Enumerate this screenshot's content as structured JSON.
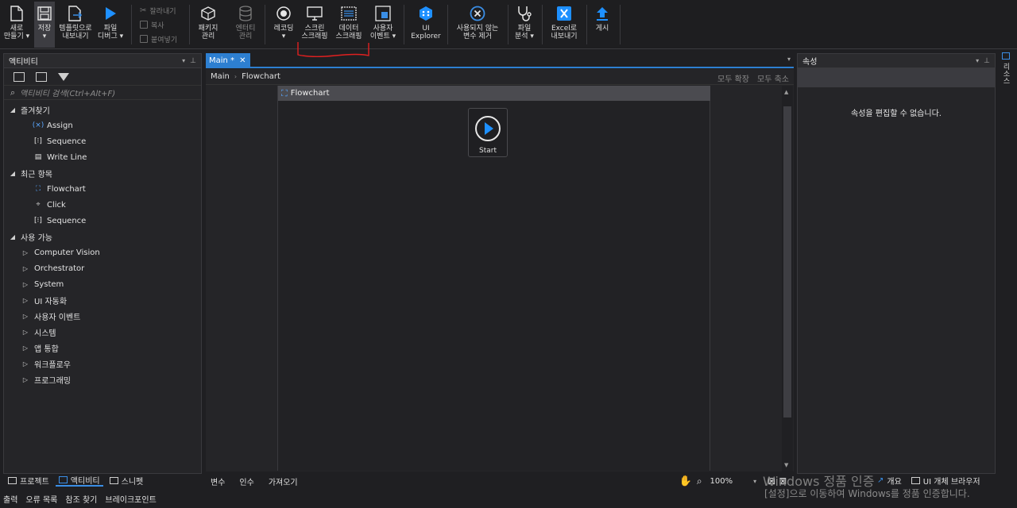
{
  "ribbon": {
    "new": "새로\n만들기 ▾",
    "save": "저장\n▾",
    "export_template": "템플릿으로\n내보내기",
    "debug_file": "파일\n디버그 ▾",
    "cut": "잘라내기",
    "copy": "복사",
    "paste": "붙여넣기",
    "manage_packages": "패키지\n관리",
    "manage_entities": "엔터티\n관리",
    "recording": "레코딩\n▾",
    "screen_scraping": "스크린\n스크래핑",
    "data_scraping": "데이터\n스크래핑",
    "user_events": "사용자\n이벤트 ▾",
    "ui_explorer": "UI\nExplorer",
    "remove_unused": "사용되지 않는\n변수 제거",
    "analyze_file": "파일\n분석 ▾",
    "export_excel": "Excel로\n내보내기",
    "publish": "게시"
  },
  "activities_panel": {
    "title": "액티비티",
    "search_placeholder": "액티비티 검색(Ctrl+Alt+F)",
    "sections": [
      {
        "label": "즐겨찾기",
        "items": [
          "Assign",
          "Sequence",
          "Write Line"
        ]
      },
      {
        "label": "최근 항목",
        "items": [
          "Flowchart",
          "Click",
          "Sequence"
        ]
      },
      {
        "label": "사용 가능",
        "items": [
          "Computer Vision",
          "Orchestrator",
          "System",
          "UI 자동화",
          "사용자 이벤트",
          "시스템",
          "앱 통합",
          "워크플로우",
          "프로그래밍"
        ]
      }
    ],
    "bottom_tabs": [
      "프로젝트",
      "액티비티",
      "스니펫"
    ]
  },
  "designer": {
    "tab": "Main *",
    "breadcrumb": [
      "Main",
      "Flowchart"
    ],
    "expand_all": "모두 확장",
    "collapse_all": "모두 축소",
    "flowchart_title": "Flowchart",
    "start_label": "Start",
    "status_tabs": [
      "변수",
      "인수",
      "가져오기"
    ],
    "zoom": "100%"
  },
  "properties_panel": {
    "title": "속성",
    "empty_message": "속성을 편집할 수 없습니다."
  },
  "right_strip": "리소스",
  "status_right": {
    "overview": "개요",
    "ui_browser": "UI 개체 브라우저"
  },
  "bottom_output_tabs": [
    "출력",
    "오류 목록",
    "참조 찾기",
    "브레이크포인트"
  ],
  "watermark": {
    "line1": "Windows 정품 인증",
    "line2": "[설정]으로 이동하여 Windows를 정품 인증합니다."
  },
  "colors": {
    "accent": "#2d7fd1",
    "annotation": "#e02020"
  }
}
